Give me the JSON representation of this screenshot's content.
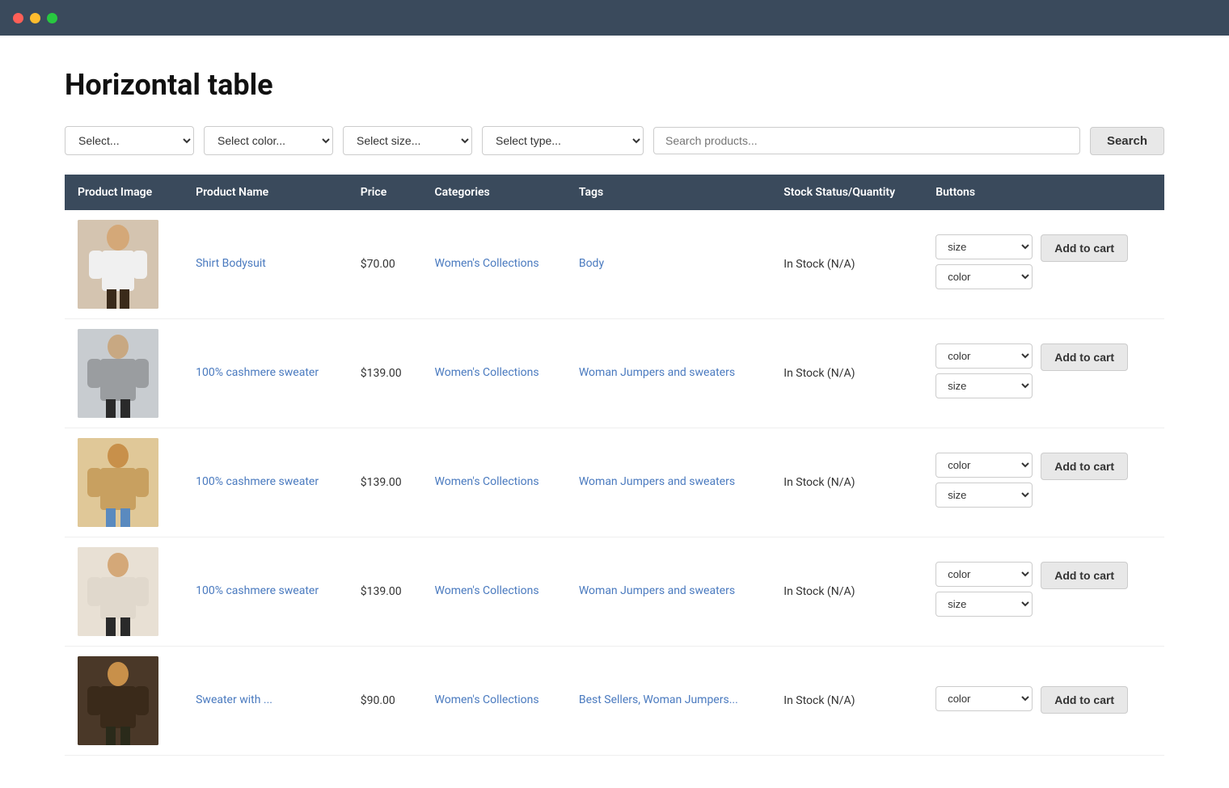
{
  "titlebar": {
    "traffic_lights": [
      "red",
      "yellow",
      "green"
    ]
  },
  "page": {
    "title": "Horizontal table"
  },
  "filters": {
    "select_placeholder": "Select...",
    "color_placeholder": "Select color...",
    "size_placeholder": "Select size...",
    "type_placeholder": "Select type...",
    "search_placeholder": "Search products...",
    "search_label": "Search"
  },
  "table": {
    "headers": [
      "Product Image",
      "Product Name",
      "Price",
      "Categories",
      "Tags",
      "Stock Status/Quantity",
      "Buttons"
    ],
    "rows": [
      {
        "id": 1,
        "name": "Shirt Bodysuit",
        "price": "$70.00",
        "category": "Women's Collections",
        "tags": "Body",
        "stock": "In Stock (N/A)",
        "img_class": "img-1",
        "has_size": true,
        "has_color": true,
        "size_first": true,
        "add_to_cart_label": "Add to cart"
      },
      {
        "id": 2,
        "name": "100% cashmere sweater",
        "price": "$139.00",
        "category": "Women's Collections",
        "tags": "Woman Jumpers and sweaters",
        "stock": "In Stock (N/A)",
        "img_class": "img-2",
        "has_size": true,
        "has_color": true,
        "size_first": false,
        "add_to_cart_label": "Add to cart"
      },
      {
        "id": 3,
        "name": "100% cashmere sweater",
        "price": "$139.00",
        "category": "Women's Collections",
        "tags": "Woman Jumpers and sweaters",
        "stock": "In Stock (N/A)",
        "img_class": "img-3",
        "has_size": true,
        "has_color": true,
        "size_first": false,
        "add_to_cart_label": "Add to cart"
      },
      {
        "id": 4,
        "name": "100% cashmere sweater",
        "price": "$139.00",
        "category": "Women's Collections",
        "tags": "Woman Jumpers and sweaters",
        "stock": "In Stock (N/A)",
        "img_class": "img-4",
        "has_size": true,
        "has_color": true,
        "size_first": false,
        "add_to_cart_label": "Add to cart"
      },
      {
        "id": 5,
        "name": "Sweater with ...",
        "price": "$90.00",
        "category": "Women's Collections",
        "tags": "Best Sellers, Woman Jumpers...",
        "stock": "In Stock (N/A)",
        "img_class": "img-5",
        "has_size": false,
        "has_color": true,
        "size_first": false,
        "add_to_cart_label": "Add to cart"
      }
    ],
    "select_options": {
      "color_label": "color",
      "size_label": "size"
    }
  }
}
